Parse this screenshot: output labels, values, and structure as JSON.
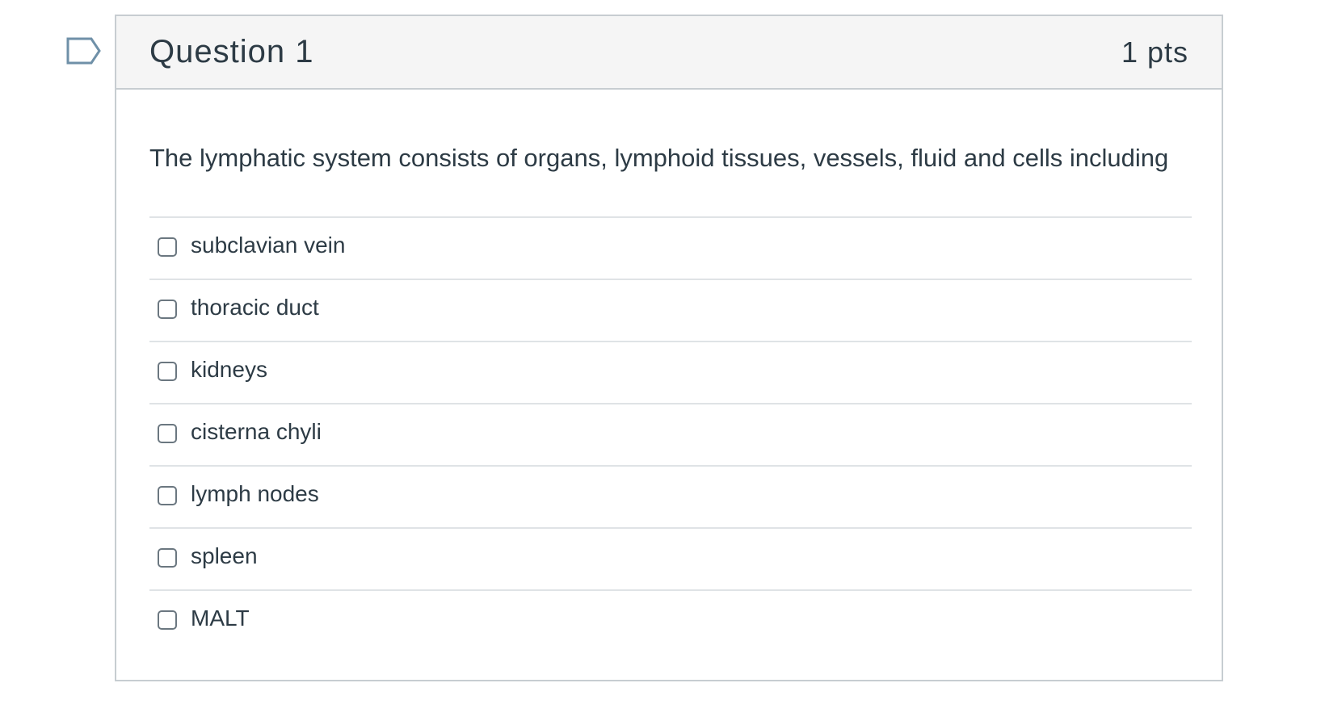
{
  "question": {
    "title": "Question 1",
    "points": "1 pts",
    "text": "The lymphatic system consists of organs, lymphoid tissues, vessels, fluid and cells including"
  },
  "answers": [
    {
      "label": "subclavian vein",
      "checked": false
    },
    {
      "label": "thoracic duct",
      "checked": false
    },
    {
      "label": "kidneys",
      "checked": false
    },
    {
      "label": "cisterna chyli",
      "checked": false
    },
    {
      "label": "lymph nodes",
      "checked": false
    },
    {
      "label": "spleen",
      "checked": false
    },
    {
      "label": "MALT",
      "checked": false
    }
  ],
  "icons": {
    "flag": "flag-question-icon",
    "checkbox": "checkbox-icon"
  },
  "colors": {
    "text": "#2d3b45",
    "border": "#c7cdd1",
    "header_bg": "#f5f5f5",
    "divider": "#dfe3e6",
    "flag": "#6f90a8"
  }
}
